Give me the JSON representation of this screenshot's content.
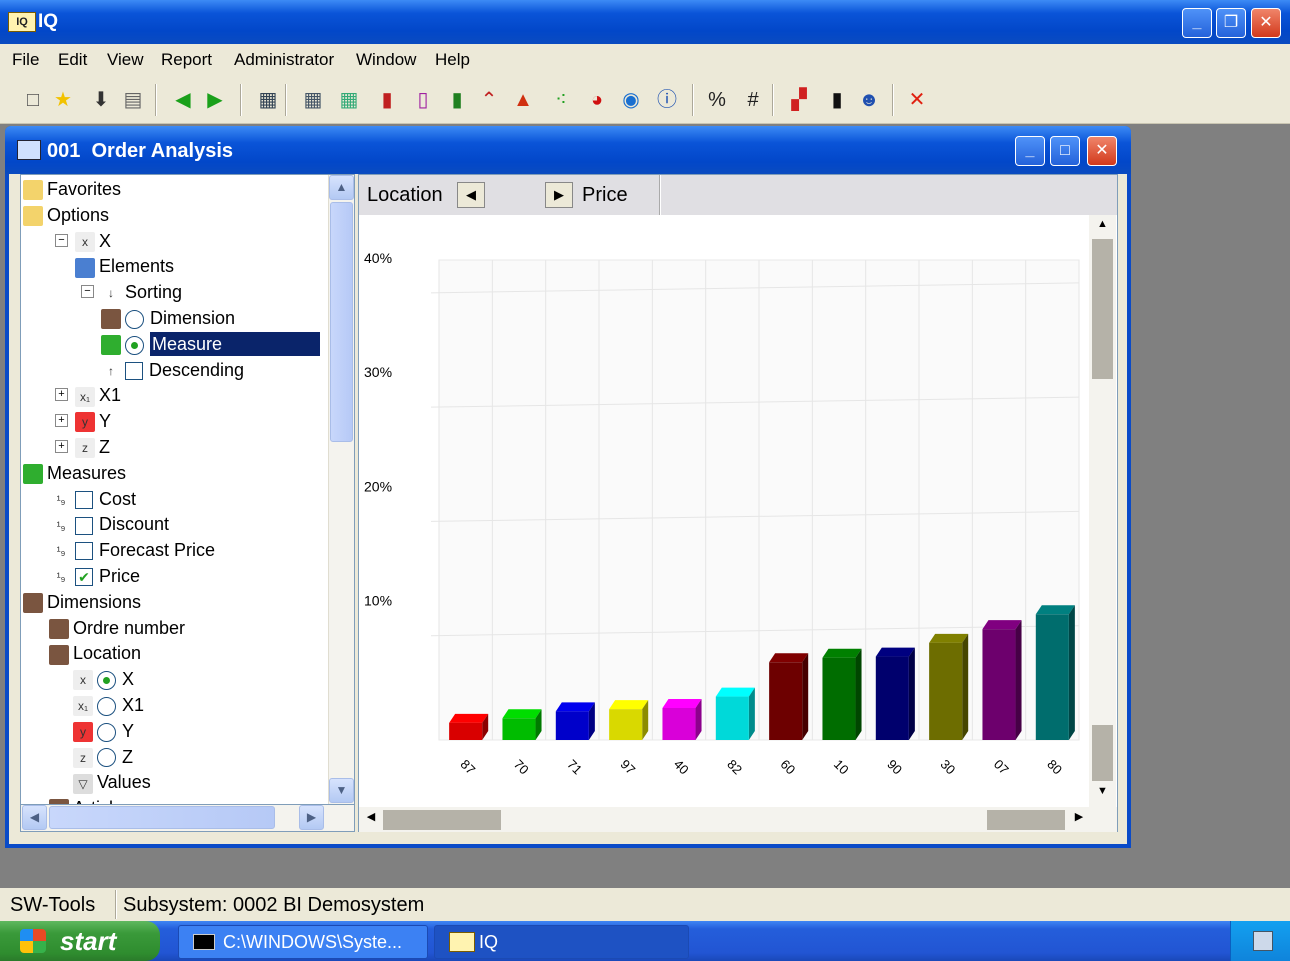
{
  "app": {
    "title": "IQ",
    "icon_text": "IQ"
  },
  "menu": [
    "File",
    "Edit",
    "View",
    "Report",
    "Administrator",
    "Window",
    "Help"
  ],
  "toolbar_icons": [
    "new-icon",
    "favorite-star-icon",
    "import-icon",
    "print-icon",
    "back-icon",
    "forward-icon",
    "layout-icon",
    "table-icon",
    "table-add-icon",
    "bar-chart-icon",
    "bar-chart-2-icon",
    "bar-chart-3-icon",
    "line-chart-icon",
    "area-chart-icon",
    "scatter-chart-icon",
    "pie-chart-icon",
    "globe-icon",
    "info-icon",
    "percent-icon",
    "number-icon",
    "colors-icon",
    "traffic-light-icon",
    "users-icon",
    "close-red-icon"
  ],
  "toolbar_labels": {
    "percent": "%",
    "number": "#"
  },
  "child": {
    "title": "001  Order Analysis"
  },
  "tree": [
    {
      "id": "favorites",
      "label": "Favorites",
      "icon": "favorites-folder-icon"
    },
    {
      "id": "options",
      "label": "Options",
      "icon": "folder-open-icon"
    },
    {
      "id": "x-axis",
      "label": "X",
      "icon": "x-axis-icon",
      "pm": "−"
    },
    {
      "id": "elements",
      "label": "Elements",
      "icon": "elements-icon"
    },
    {
      "id": "sorting",
      "label": "Sorting",
      "icon": "sort-icon",
      "pm": "−"
    },
    {
      "id": "dimension",
      "label": "Dimension",
      "icon": "dimension-icon",
      "radio": false
    },
    {
      "id": "measure",
      "label": "Measure",
      "icon": "sum-icon",
      "radio": true,
      "selected": true
    },
    {
      "id": "descending",
      "label": "Descending",
      "icon": "sort-desc-icon",
      "check": false
    },
    {
      "id": "x1-axis",
      "label": "X1",
      "icon": "x1-axis-icon",
      "pm": "+"
    },
    {
      "id": "y-axis",
      "label": "Y",
      "icon": "y-axis-icon",
      "pm": "+"
    },
    {
      "id": "z-axis",
      "label": "Z",
      "icon": "z-axis-icon",
      "pm": "+"
    },
    {
      "id": "measures",
      "label": "Measures",
      "icon": "sum-icon"
    },
    {
      "id": "cost",
      "label": "Cost",
      "icon": "measure-icon",
      "check": false
    },
    {
      "id": "discount",
      "label": "Discount",
      "icon": "measure-icon",
      "check": false
    },
    {
      "id": "forecast-price",
      "label": "Forecast Price",
      "icon": "measure-icon",
      "check": false
    },
    {
      "id": "price",
      "label": "Price",
      "icon": "measure-icon",
      "check": true
    },
    {
      "id": "dimensions",
      "label": "Dimensions",
      "icon": "dimensions-icon"
    },
    {
      "id": "ordre-number",
      "label": "Ordre number",
      "icon": "dimension-icon"
    },
    {
      "id": "location",
      "label": "Location",
      "icon": "dimension-icon"
    },
    {
      "id": "loc-x",
      "label": "X",
      "icon": "x-axis-icon",
      "radio": true
    },
    {
      "id": "loc-x1",
      "label": "X1",
      "icon": "x1-axis-icon",
      "radio": false
    },
    {
      "id": "loc-y",
      "label": "Y",
      "icon": "y-axis-icon",
      "radio": false
    },
    {
      "id": "loc-z",
      "label": "Z",
      "icon": "z-axis-icon",
      "radio": false
    },
    {
      "id": "values",
      "label": "Values",
      "icon": "filter-icon"
    },
    {
      "id": "article",
      "label": "Article",
      "icon": "dimension-icon"
    }
  ],
  "chart_header": {
    "dimension": "Location",
    "measure": "Price"
  },
  "chart_data": {
    "type": "bar",
    "categories": [
      "87",
      "70",
      "71",
      "97",
      "40",
      "82",
      "60",
      "10",
      "90",
      "30",
      "07",
      "80"
    ],
    "values": [
      1.5,
      1.9,
      2.5,
      2.7,
      2.8,
      3.8,
      6.8,
      7.2,
      7.3,
      8.5,
      9.7,
      11.0
    ],
    "colors": [
      "#ff0000",
      "#00dd00",
      "#0000ee",
      "#ffff00",
      "#ff00ff",
      "#00ffff",
      "#800000",
      "#008000",
      "#000080",
      "#808000",
      "#800080",
      "#008080"
    ],
    "ylim": [
      0,
      42
    ],
    "yticks": [
      "10%",
      "20%",
      "30%",
      "40%"
    ],
    "ytick_values": [
      10,
      20,
      30,
      40
    ],
    "grid": true
  },
  "status": {
    "left": "SW-Tools",
    "right": "Subsystem: 0002 BI Demosystem"
  },
  "taskbar": {
    "start": "start",
    "tasks": [
      "C:\\WINDOWS\\Syste...",
      "IQ"
    ]
  }
}
